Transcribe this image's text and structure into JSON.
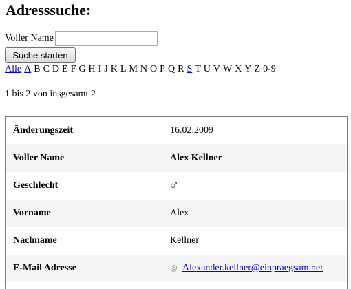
{
  "page": {
    "title": "Adresssuche:"
  },
  "search": {
    "label": "Voller Name",
    "value": "",
    "button_label": "Suche starten"
  },
  "letters": [
    {
      "label": "Alle",
      "link": true
    },
    {
      "label": "A",
      "link": true
    },
    {
      "label": "B",
      "link": false
    },
    {
      "label": "C",
      "link": false
    },
    {
      "label": "D",
      "link": false
    },
    {
      "label": "E",
      "link": false
    },
    {
      "label": "F",
      "link": false
    },
    {
      "label": "G",
      "link": false
    },
    {
      "label": "H",
      "link": false
    },
    {
      "label": "I",
      "link": false
    },
    {
      "label": "J",
      "link": false
    },
    {
      "label": "K",
      "link": false
    },
    {
      "label": "L",
      "link": false
    },
    {
      "label": "M",
      "link": false
    },
    {
      "label": "N",
      "link": false
    },
    {
      "label": "O",
      "link": false
    },
    {
      "label": "P",
      "link": false
    },
    {
      "label": "Q",
      "link": false
    },
    {
      "label": "R",
      "link": false
    },
    {
      "label": "S",
      "link": true
    },
    {
      "label": "T",
      "link": false
    },
    {
      "label": "U",
      "link": false
    },
    {
      "label": "V",
      "link": false
    },
    {
      "label": "W",
      "link": false
    },
    {
      "label": "X",
      "link": false
    },
    {
      "label": "Y",
      "link": false
    },
    {
      "label": "Z",
      "link": false
    },
    {
      "label": "0-9",
      "link": false
    }
  ],
  "results": {
    "summary": "1 bis 2 von insgesamt 2"
  },
  "record": {
    "changed_label": "Änderungszeit",
    "changed_value": "16.02.2009",
    "fullname_label": "Voller Name",
    "fullname_value": "Alex Kellner",
    "gender_label": "Geschlecht",
    "gender_icon": "male-symbol-icon",
    "firstname_label": "Vorname",
    "firstname_value": "Alex",
    "lastname_label": "Nachname",
    "lastname_value": "Kellner",
    "email_label": "E-Mail Adresse",
    "email_icon": "at-icon",
    "email_value": "Alexander.kellner@einpraegsam.net"
  }
}
